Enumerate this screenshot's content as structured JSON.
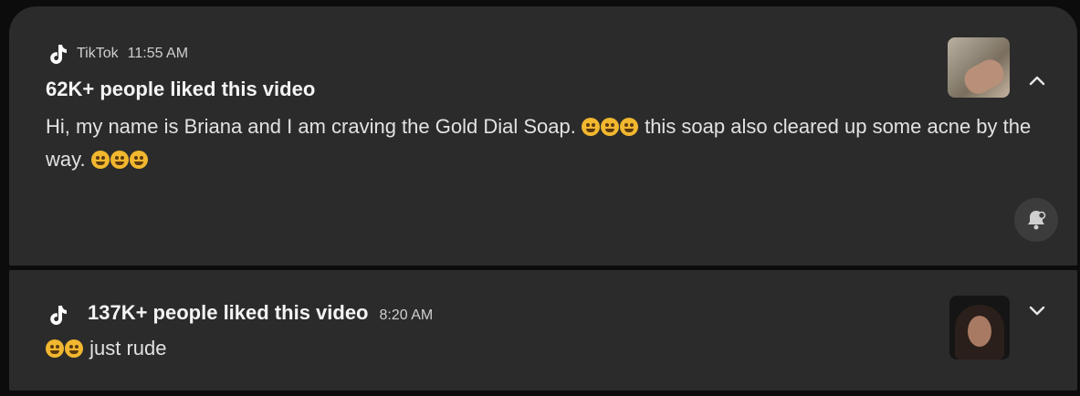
{
  "notifications": [
    {
      "app": "TikTok",
      "time": "11:55 AM",
      "title": "62K+ people liked this video",
      "body_part1": "Hi, my name is Briana and I am craving the Gold Dial Soap.",
      "body_part2": "this soap also cleared up some acne by the way.",
      "expanded": true,
      "icons": [
        "tiktok-logo",
        "chevron-up-icon",
        "bell-settings-icon"
      ]
    },
    {
      "title": "137K+ people liked this video",
      "time": "8:20 AM",
      "body": "just rude",
      "expanded": false,
      "icons": [
        "tiktok-logo",
        "chevron-down-icon"
      ]
    }
  ],
  "colors": {
    "card_background": "#2b2b2b",
    "screen_background": "#0c0c0c",
    "text_primary": "#f4f4f4",
    "text_secondary": "#cfcfcf"
  }
}
